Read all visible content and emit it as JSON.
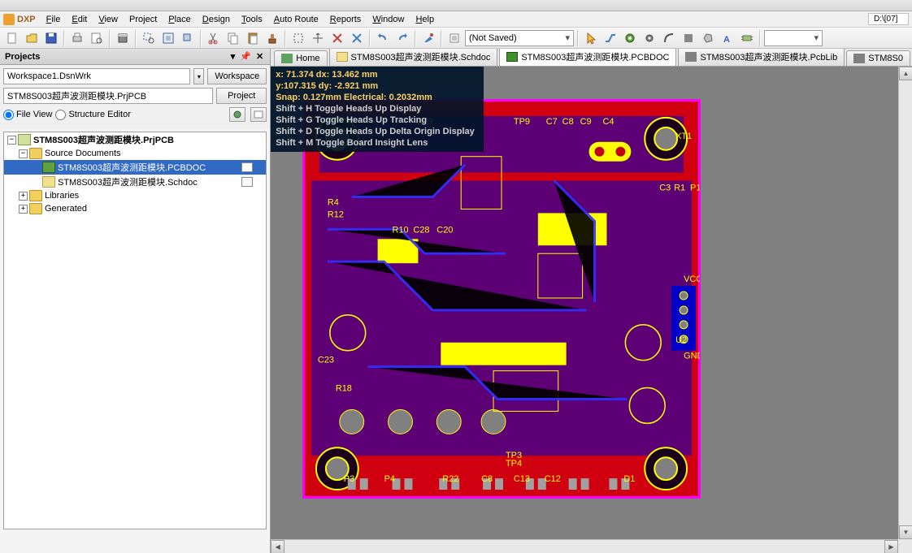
{
  "title_fragment": "...",
  "path_display": "D:\\[07]",
  "menu": {
    "logo": "DXP",
    "items": [
      "File",
      "Edit",
      "View",
      "Project",
      "Place",
      "Design",
      "Tools",
      "Auto Route",
      "Reports",
      "Window",
      "Help"
    ]
  },
  "toolbar": {
    "not_saved": "(Not Saved)"
  },
  "projects_panel": {
    "title": "Projects",
    "workspace_value": "Workspace1.DsnWrk",
    "workspace_btn": "Workspace",
    "project_value": "STM8S003超声波测距模块.PrjPCB",
    "project_btn": "Project",
    "radio_file": "File View",
    "radio_structure": "Structure Editor"
  },
  "tree": {
    "root": "STM8S003超声波测距模块.PrjPCB",
    "source_docs": "Source Documents",
    "pcbdoc": "STM8S003超声波测距模块.PCBDOC",
    "schdoc": "STM8S003超声波测距模块.Schdoc",
    "libraries": "Libraries",
    "generated": "Generated"
  },
  "doc_tabs": {
    "home": "Home",
    "sch": "STM8S003超声波测距模块.Schdoc",
    "pcb": "STM8S003超声波测距模块.PCBDOC",
    "pcblib": "STM8S003超声波测距模块.PcbLib",
    "lib_short": "STM8S0"
  },
  "hud": {
    "l1": "x: 71.374    dx: 13.462  mm",
    "l2": "y:107.315    dy:  -2.921   mm",
    "l3": "Snap: 0.127mm Electrical: 0.2032mm",
    "l4": "Shift + H   Toggle Heads Up Display",
    "l5": "Shift + G   Toggle Heads Up Tracking",
    "l6": "Shift + D   Toggle Heads Up Delta Origin Display",
    "l7": "Shift + M   Toggle Board Insight Lens"
  }
}
